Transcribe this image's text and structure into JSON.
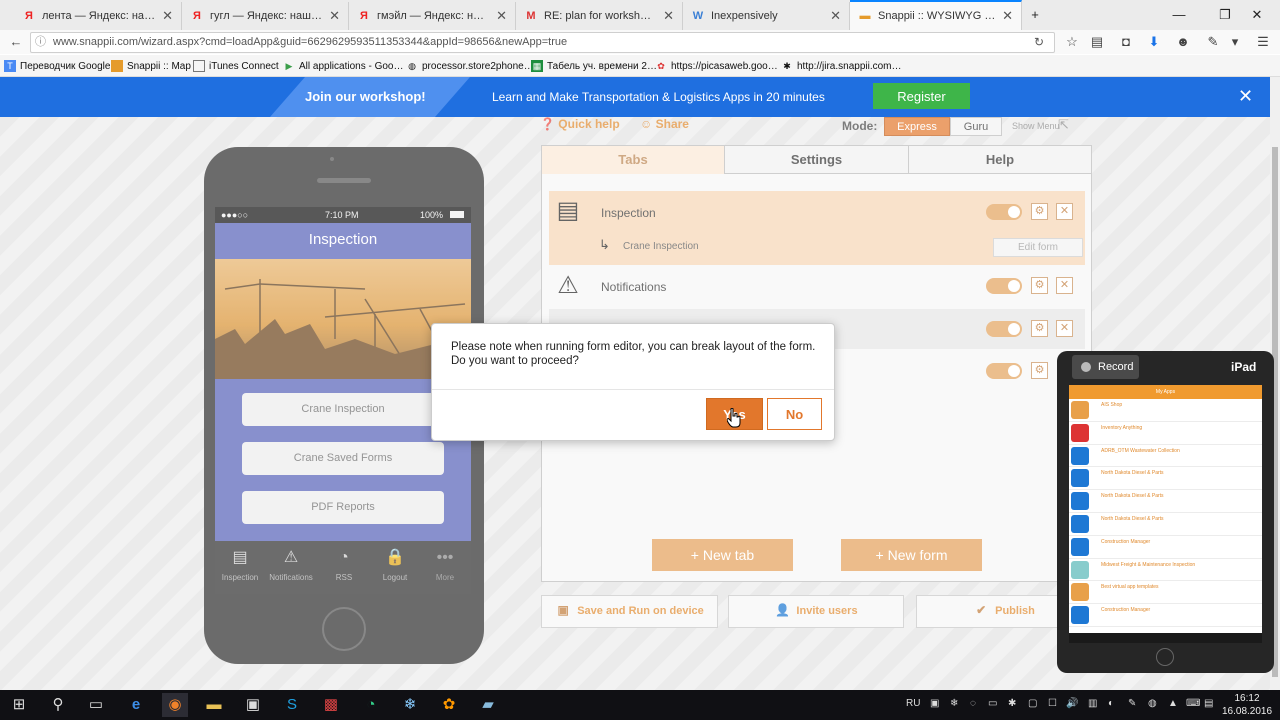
{
  "browser": {
    "tabs": [
      {
        "label": "лента — Яндекс: нашлос…",
        "icon": "yandex-icon"
      },
      {
        "label": "гугл — Яндекс: нашлось 6…",
        "icon": "yandex-icon"
      },
      {
        "label": "гмэйл — Яндекс: нашло…",
        "icon": "yandex-icon"
      },
      {
        "label": "RE: plan for workshops - k…",
        "icon": "gmail-icon"
      },
      {
        "label": "Inexpensively",
        "icon": "wordpress-icon"
      },
      {
        "label": "Snappii :: WYSIWYG Editor",
        "icon": "snappii-icon"
      }
    ],
    "url": "www.snappii.com/wizard.aspx?cmd=loadApp&guid=6629629593511353344&appId=98656&newApp=true",
    "bookmarks": [
      "Переводчик Google",
      "Snappii :: Map",
      "iTunes Connect",
      "All applications - Goo…",
      "processor.store2phone…",
      "Табель уч. времени 2…",
      "https://picasaweb.goo…",
      "http://jira.snappii.com…"
    ]
  },
  "banner": {
    "title": "Join our workshop!",
    "subtitle": "Learn and Make Transportation & Logistics Apps in 20 minutes",
    "register_label": "Register"
  },
  "toolbar": {
    "quick_help": "Quick help",
    "share": "Share",
    "mode_label": "Mode:",
    "mode_express": "Express",
    "mode_guru": "Guru",
    "show_menu": "Show Menu"
  },
  "phone": {
    "carrier": "●●●○○",
    "time": "7:10 PM",
    "battery": "100%",
    "title": "Inspection",
    "buttons": [
      "Crane Inspection",
      "Crane Saved Forms",
      "PDF Reports"
    ],
    "tabbar": [
      "Inspection",
      "Notifications",
      "RSS",
      "Logout",
      "More"
    ]
  },
  "panel": {
    "tabs": [
      "Tabs",
      "Settings",
      "Help"
    ],
    "rows": [
      {
        "name": "Inspection",
        "icon": "clipboard-icon"
      },
      {
        "name": "Notifications",
        "icon": "alert-icon"
      }
    ],
    "subitem": "Crane Inspection",
    "edit_form": "Edit form",
    "new_tab": "+ New tab",
    "new_form": "+ New form"
  },
  "actions": {
    "save_run": "Save and Run on device",
    "invite": "Invite users",
    "publish": "Publish"
  },
  "dialog": {
    "message_line1": "Please note when running form editor, you can break layout of the form.",
    "message_line2": "Do you want to proceed?",
    "yes": "Yes",
    "no": "No"
  },
  "ipad": {
    "record": "Record",
    "label": "iPad",
    "header": "My Apps",
    "apps": [
      "AIS Shop",
      "Inventory Anything",
      "ADRB_OTM Wastewater Collection",
      "North Dakota Diesel & Parts",
      "North Dakota Diesel & Parts",
      "North Dakota Diesel & Parts",
      "Construction Manager",
      "Midwest Freight & Maintenance Inspection",
      "Best virtual app templates",
      "Construction Manager"
    ]
  },
  "taskbar": {
    "lang": "RU",
    "time": "16:12",
    "date": "16.08.2016"
  }
}
